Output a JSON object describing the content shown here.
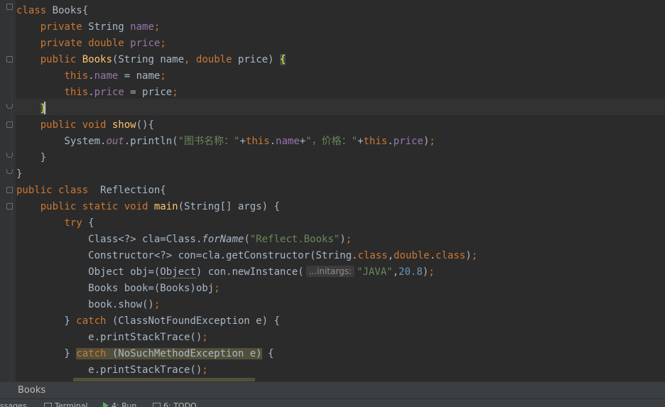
{
  "editor": {
    "lines": [
      [
        [
          "kw",
          "class "
        ],
        [
          "p",
          "Books{"
        ]
      ],
      [
        [
          "p",
          "    "
        ],
        [
          "kw",
          "private "
        ],
        [
          "p",
          "String "
        ],
        [
          "fld",
          "name"
        ],
        [
          "kw",
          ";"
        ]
      ],
      [
        [
          "p",
          "    "
        ],
        [
          "kw",
          "private double "
        ],
        [
          "fld",
          "price"
        ],
        [
          "kw",
          ";"
        ]
      ],
      [
        [
          "p",
          "    "
        ],
        [
          "kw",
          "public "
        ],
        [
          "fn",
          "Books"
        ],
        [
          "p",
          "(String name"
        ],
        [
          "kw",
          ", double "
        ],
        [
          "p",
          "price) "
        ],
        [
          "brace",
          "{"
        ]
      ],
      [
        [
          "p",
          "        "
        ],
        [
          "kw",
          "this"
        ],
        [
          "p",
          "."
        ],
        [
          "fld",
          "name"
        ],
        [
          "p",
          " = name"
        ],
        [
          "kw",
          ";"
        ]
      ],
      [
        [
          "p",
          "        "
        ],
        [
          "kw",
          "this"
        ],
        [
          "p",
          "."
        ],
        [
          "fld",
          "price"
        ],
        [
          "p",
          " = price"
        ],
        [
          "kw",
          ";"
        ]
      ],
      [
        [
          "p",
          "    "
        ],
        [
          "brace",
          "}"
        ]
      ],
      [
        [
          "p",
          "    "
        ],
        [
          "kw",
          "public void "
        ],
        [
          "fn",
          "show"
        ],
        [
          "p",
          "(){"
        ]
      ],
      [
        [
          "p",
          "        System."
        ],
        [
          "st",
          "out"
        ],
        [
          "p",
          ".println("
        ],
        [
          "str",
          "\"图书名称：\""
        ],
        [
          "p",
          "+"
        ],
        [
          "kw",
          "this"
        ],
        [
          "p",
          "."
        ],
        [
          "fld",
          "name"
        ],
        [
          "p",
          "+"
        ],
        [
          "str",
          "\"，价格：\""
        ],
        [
          "p",
          "+"
        ],
        [
          "kw",
          "this"
        ],
        [
          "p",
          "."
        ],
        [
          "fld",
          "price"
        ],
        [
          "p",
          ")"
        ],
        [
          "kw",
          ";"
        ]
      ],
      [
        [
          "p",
          "    }"
        ]
      ],
      [
        [
          "p",
          "}"
        ]
      ],
      [
        [
          "kw",
          "public class  "
        ],
        [
          "p",
          "Reflection{"
        ]
      ],
      [
        [
          "p",
          "    "
        ],
        [
          "kw",
          "public static void "
        ],
        [
          "fn",
          "main"
        ],
        [
          "p",
          "(String[] args) {"
        ]
      ],
      [
        [
          "p",
          "        "
        ],
        [
          "kw",
          "try "
        ],
        [
          "p",
          "{"
        ]
      ],
      [
        [
          "p",
          "            Class<?> cla=Class."
        ],
        [
          "stm",
          "forName"
        ],
        [
          "p",
          "("
        ],
        [
          "str",
          "\"Reflect.Books\""
        ],
        [
          "p",
          ")"
        ],
        [
          "kw",
          ";"
        ]
      ],
      [
        [
          "p",
          "            Constructor<?> con=cla.getConstructor(String."
        ],
        [
          "kw",
          "class"
        ],
        [
          "p",
          ","
        ],
        [
          "kw",
          "double"
        ],
        [
          "p",
          "."
        ],
        [
          "kw",
          "class"
        ],
        [
          "p",
          ")"
        ],
        [
          "kw",
          ";"
        ]
      ],
      [
        [
          "p",
          "            Object obj=("
        ],
        [
          "warn",
          "Object"
        ],
        [
          "p",
          ") con.newInstance("
        ],
        [
          "hint",
          "...initargs:"
        ],
        [
          "str",
          "\"JAVA\""
        ],
        [
          "p",
          ","
        ],
        [
          "num",
          "20.8"
        ],
        [
          "p",
          ")"
        ],
        [
          "kw",
          ";"
        ]
      ],
      [
        [
          "p",
          "            Books book=(Books)obj"
        ],
        [
          "kw",
          ";"
        ]
      ],
      [
        [
          "p",
          "            book.show()"
        ],
        [
          "kw",
          ";"
        ]
      ],
      [
        [
          "p",
          "        } "
        ],
        [
          "kw",
          "catch "
        ],
        [
          "p",
          "(ClassNotFoundException e) {"
        ]
      ],
      [
        [
          "p",
          "            e.printStackTrace()"
        ],
        [
          "kw",
          ";"
        ]
      ],
      [
        [
          "p",
          "        } "
        ],
        [
          "hl:kw",
          "catch "
        ],
        [
          "hl:p",
          "(NoSuchMethodException e)"
        ],
        [
          "p",
          " {"
        ]
      ],
      [
        [
          "p",
          "            e.printStackTrace()"
        ],
        [
          "kw",
          ";"
        ]
      ]
    ]
  },
  "breadcrumb": {
    "label": "Books"
  },
  "toolwindows": [
    {
      "icon": "messages-icon",
      "label": "ssages"
    },
    {
      "icon": "terminal-icon",
      "label": "Terminal"
    },
    {
      "icon": "run-icon",
      "label": "4: Run"
    },
    {
      "icon": "todo-icon",
      "label": "6: TODO"
    }
  ],
  "colors": {
    "background": "#2b2b2b",
    "keyword": "#cc7832",
    "field": "#9876aa",
    "string": "#6a8759",
    "number": "#6897bb",
    "method": "#ffc66d",
    "text": "#a9b7c6"
  }
}
